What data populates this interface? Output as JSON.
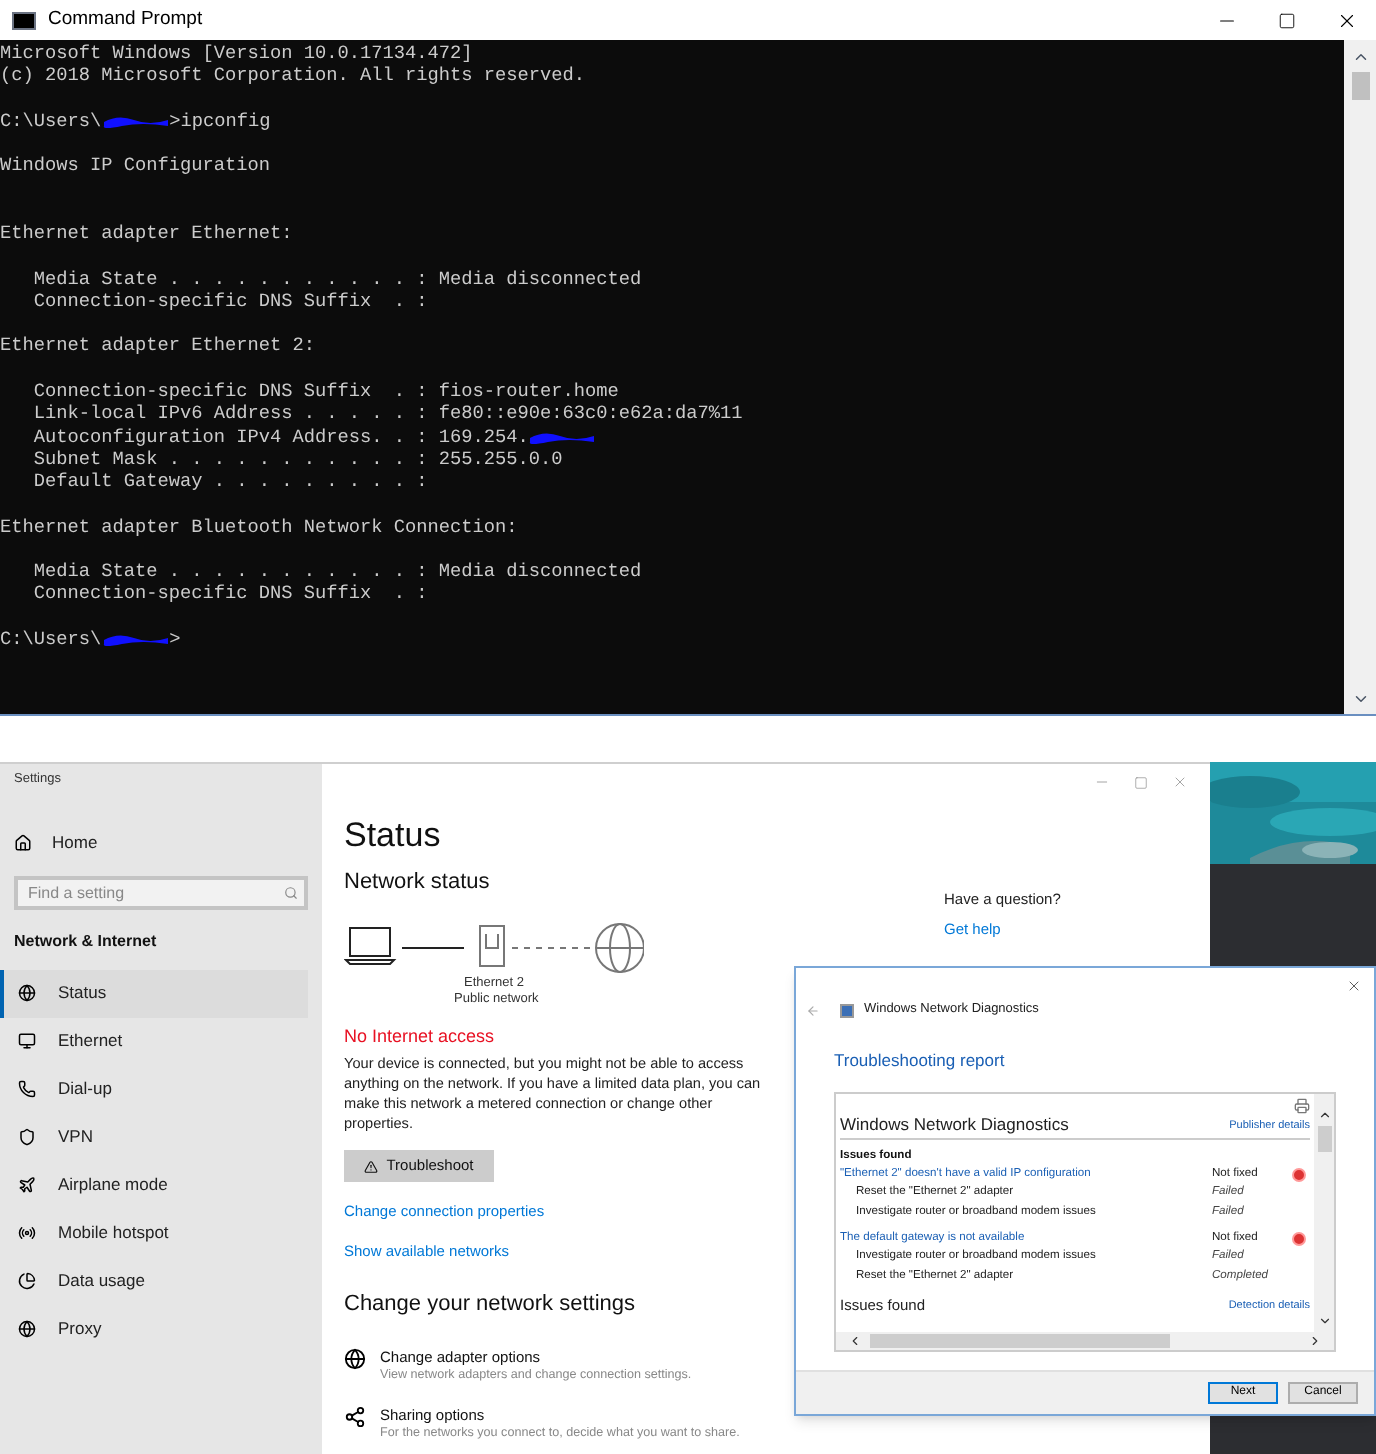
{
  "cmd": {
    "title": "Command Prompt",
    "lines": [
      {
        "kind": "text",
        "text": "Microsoft Windows [Version 10.0.17134.472]"
      },
      {
        "kind": "text",
        "text": "(c) 2018 Microsoft Corporation. All rights reserved."
      },
      {
        "kind": "blank"
      },
      {
        "kind": "redacted",
        "text": "C:\\Users\\",
        "after": ">ipconfig"
      },
      {
        "kind": "blank"
      },
      {
        "kind": "text",
        "text": "Windows IP Configuration"
      },
      {
        "kind": "blank"
      },
      {
        "kind": "blank"
      },
      {
        "kind": "text",
        "text": "Ethernet adapter Ethernet:"
      },
      {
        "kind": "blank"
      },
      {
        "kind": "text",
        "text": "   Media State . . . . . . . . . . . : Media disconnected"
      },
      {
        "kind": "text",
        "text": "   Connection-specific DNS Suffix  . :"
      },
      {
        "kind": "blank"
      },
      {
        "kind": "text",
        "text": "Ethernet adapter Ethernet 2:"
      },
      {
        "kind": "blank"
      },
      {
        "kind": "text",
        "text": "   Connection-specific DNS Suffix  . : fios-router.home"
      },
      {
        "kind": "text",
        "text": "   Link-local IPv6 Address . . . . . : fe80::e90e:63c0:e62a:da7%11"
      },
      {
        "kind": "redacted",
        "text": "   Autoconfiguration IPv4 Address. . : 169.254."
      },
      {
        "kind": "text",
        "text": "   Subnet Mask . . . . . . . . . . . : 255.255.0.0"
      },
      {
        "kind": "text",
        "text": "   Default Gateway . . . . . . . . . :"
      },
      {
        "kind": "blank"
      },
      {
        "kind": "text",
        "text": "Ethernet adapter Bluetooth Network Connection:"
      },
      {
        "kind": "blank"
      },
      {
        "kind": "text",
        "text": "   Media State . . . . . . . . . . . : Media disconnected"
      },
      {
        "kind": "text",
        "text": "   Connection-specific DNS Suffix  . :"
      },
      {
        "kind": "blank"
      },
      {
        "kind": "redacted",
        "text": "C:\\Users\\",
        "after": ">"
      }
    ]
  },
  "settings": {
    "title": "Settings",
    "home": "Home",
    "search": {
      "placeholder": "Find a setting"
    },
    "section": "Network & Internet",
    "sidebar": {
      "items": [
        {
          "label": "Status",
          "selected": true
        },
        {
          "label": "Ethernet",
          "selected": false
        },
        {
          "label": "Dial-up",
          "selected": false
        },
        {
          "label": "VPN",
          "selected": false
        },
        {
          "label": "Airplane mode",
          "selected": false
        },
        {
          "label": "Mobile hotspot",
          "selected": false
        },
        {
          "label": "Data usage",
          "selected": false
        },
        {
          "label": "Proxy",
          "selected": false
        }
      ]
    },
    "heading": "Status",
    "subheading": "Network status",
    "diagram": {
      "adapter": "Ethernet 2",
      "network": "Public network"
    },
    "alert": "No Internet access",
    "message": "Your device is connected, but you might not be able to access anything on the network. If you have a limited data plan, you can make this network a metered connection or change other properties.",
    "troubleshoot": "Troubleshoot",
    "links": [
      "Change connection properties",
      "Show available networks"
    ],
    "settings_heading": "Change your network settings",
    "options": [
      {
        "title": "Change adapter options",
        "description": "View network adapters and change connection settings."
      },
      {
        "title": "Sharing options",
        "description": "For the networks you connect to, decide what you want to share."
      }
    ],
    "help": {
      "question": "Have a question?",
      "link": "Get help"
    }
  },
  "diagnostics": {
    "title": "Windows Network Diagnostics",
    "report_title": "Troubleshooting report",
    "report_heading": "Windows Network Diagnostics",
    "publisher_link": "Publisher details",
    "issues_label": "Issues found",
    "rows": [
      {
        "kind": "issue",
        "text": "\"Ethernet 2\" doesn't have a valid IP configuration",
        "status": "Not fixed"
      },
      {
        "kind": "step",
        "text": "Reset the \"Ethernet 2\" adapter",
        "status": "Failed"
      },
      {
        "kind": "step",
        "text": "Investigate router or broadband modem issues",
        "status": "Failed"
      },
      {
        "kind": "issue",
        "text": "The default gateway is not available",
        "status": "Not fixed"
      },
      {
        "kind": "step",
        "text": "Investigate router or broadband modem issues",
        "status": "Failed"
      },
      {
        "kind": "step",
        "text": "Reset the \"Ethernet 2\" adapter",
        "status": "Completed"
      }
    ],
    "footer_heading": "Issues found",
    "detection_link": "Detection details",
    "buttons": [
      "Next",
      "Cancel"
    ]
  }
}
